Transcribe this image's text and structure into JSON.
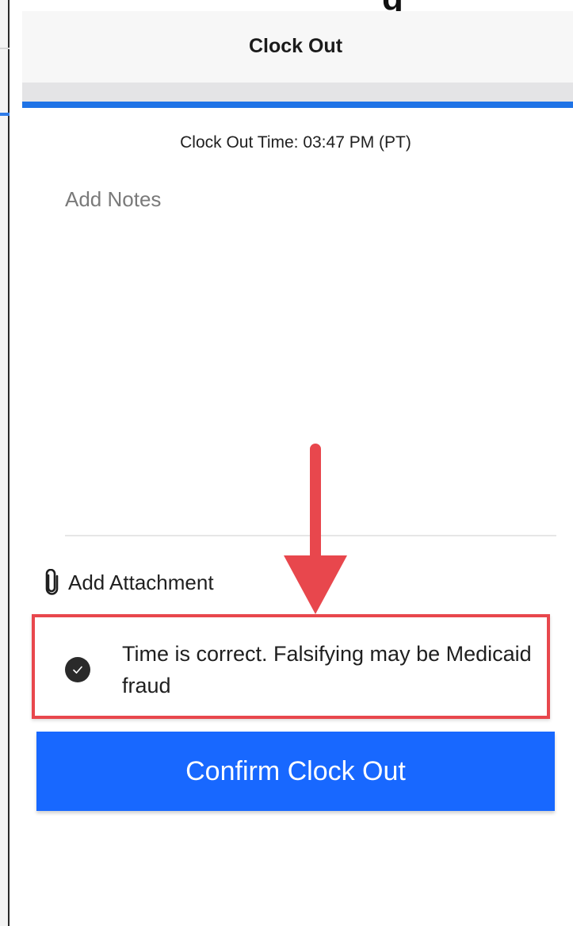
{
  "header": {
    "title": "Clock Out"
  },
  "clock_out": {
    "time_text": "Clock Out Time: 03:47 PM (PT)"
  },
  "notes": {
    "placeholder": "Add Notes",
    "value": ""
  },
  "attachment": {
    "label": "Add Attachment",
    "icon": "paperclip-icon"
  },
  "attestation": {
    "checked": true,
    "text": "Time is correct. Falsifying may be Medicaid fraud",
    "highlight_color": "#e8474d"
  },
  "actions": {
    "confirm_label": "Confirm Clock Out"
  },
  "colors": {
    "accent": "#1f73e6",
    "button": "#1868ff",
    "annotation": "#e8474d"
  }
}
